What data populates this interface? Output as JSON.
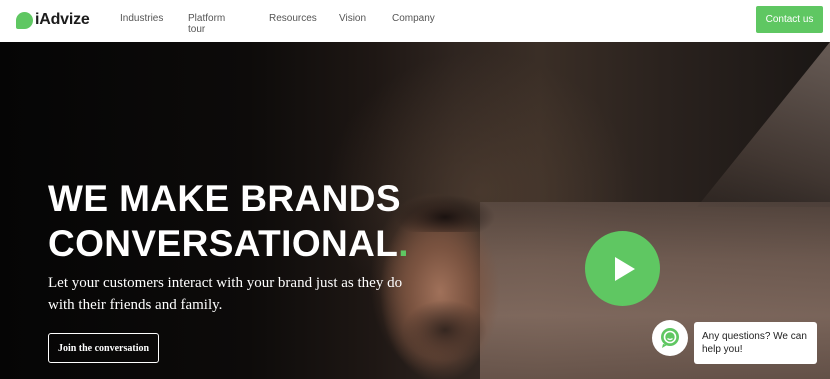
{
  "brand": {
    "name": "iAdvize",
    "accent_color": "#5fc762"
  },
  "nav": {
    "items": [
      {
        "label": "Industries"
      },
      {
        "label": "Platform tour"
      },
      {
        "label": "Resources"
      },
      {
        "label": "Vision"
      },
      {
        "label": "Company"
      }
    ],
    "cta_label": "Contact us"
  },
  "hero": {
    "headline_line1": "WE MAKE BRANDS",
    "headline_line2": "CONVERSATIONAL",
    "headline_dot": ".",
    "subtext": "Let your customers interact with your brand just as they do with their friends and family.",
    "cta_label": "Join the conversation",
    "play_icon": "play-icon"
  },
  "chat": {
    "icon": "chat-bubble-icon",
    "message": "Any questions? We can help you!"
  }
}
